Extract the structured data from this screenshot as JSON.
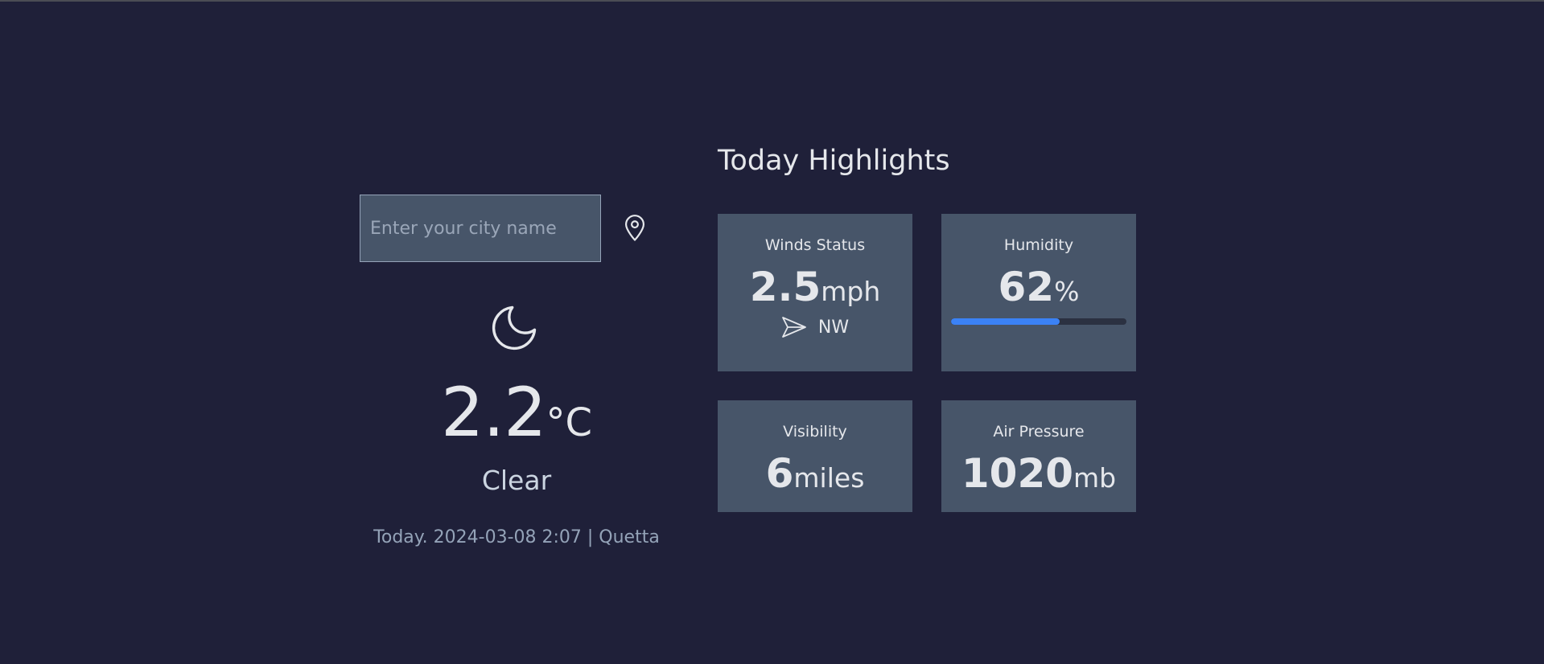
{
  "search": {
    "placeholder": "Enter your city name",
    "value": ""
  },
  "icons": {
    "location": "map-pin-icon",
    "weather": "moon-icon",
    "wind_direction": "send-arrow-icon"
  },
  "current": {
    "temperature": "2.2",
    "unit": "°C",
    "condition": "Clear",
    "meta": "Today. 2024-03-08 2:07 | Quetta"
  },
  "highlights": {
    "title": "Today Highlights",
    "wind": {
      "label": "Winds Status",
      "value": "2.5",
      "unit": "mph",
      "direction": "NW"
    },
    "humidity": {
      "label": "Humidity",
      "value": "62",
      "unit": "%",
      "percent": 62
    },
    "visibility": {
      "label": "Visibility",
      "value": "6",
      "unit": "miles"
    },
    "pressure": {
      "label": "Air Pressure",
      "value": "1020",
      "unit": "mb"
    }
  },
  "colors": {
    "background": "#1f2039",
    "card": "#475569",
    "accent": "#3b82f6",
    "track": "#2b3141"
  }
}
